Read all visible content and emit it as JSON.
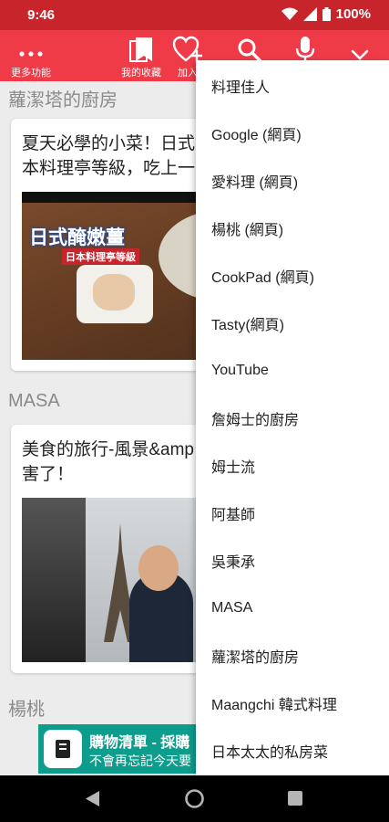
{
  "status_bar": {
    "time": "9:46",
    "battery": "100%"
  },
  "toolbar": {
    "more_label": "更多功能",
    "favorites_label": "我的收藏",
    "add_label": "加入"
  },
  "sections": [
    {
      "title": "蘿潔塔的廚房",
      "card_title": "夏天必學的小菜！日式\n本料理亭等級，吃上一",
      "thumb_title": "日式醃嫩薑",
      "thumb_subtitle": "日本料理亭等級"
    },
    {
      "title": "MASA",
      "card_title": "美食的旅行-風景&amp\n害了！"
    },
    {
      "title": "楊桃"
    }
  ],
  "banner": {
    "title": "購物清單 - 採購",
    "subtitle": "不會再忘記今天要"
  },
  "menu": {
    "items": [
      "料理佳人",
      "Google (網頁)",
      "愛料理 (網頁)",
      "楊桃 (網頁)",
      "CookPad (網頁)",
      "Tasty(網頁)",
      "YouTube",
      "詹姆士的廚房",
      "姆士流",
      "阿基師",
      "吳秉承",
      "MASA",
      "蘿潔塔的廚房",
      "Maangchi 韓式料理",
      "日本太太的私房菜"
    ]
  },
  "colors": {
    "status_bar": "#c8242c",
    "toolbar": "#ef3b48",
    "banner": "#0d9d8d"
  }
}
